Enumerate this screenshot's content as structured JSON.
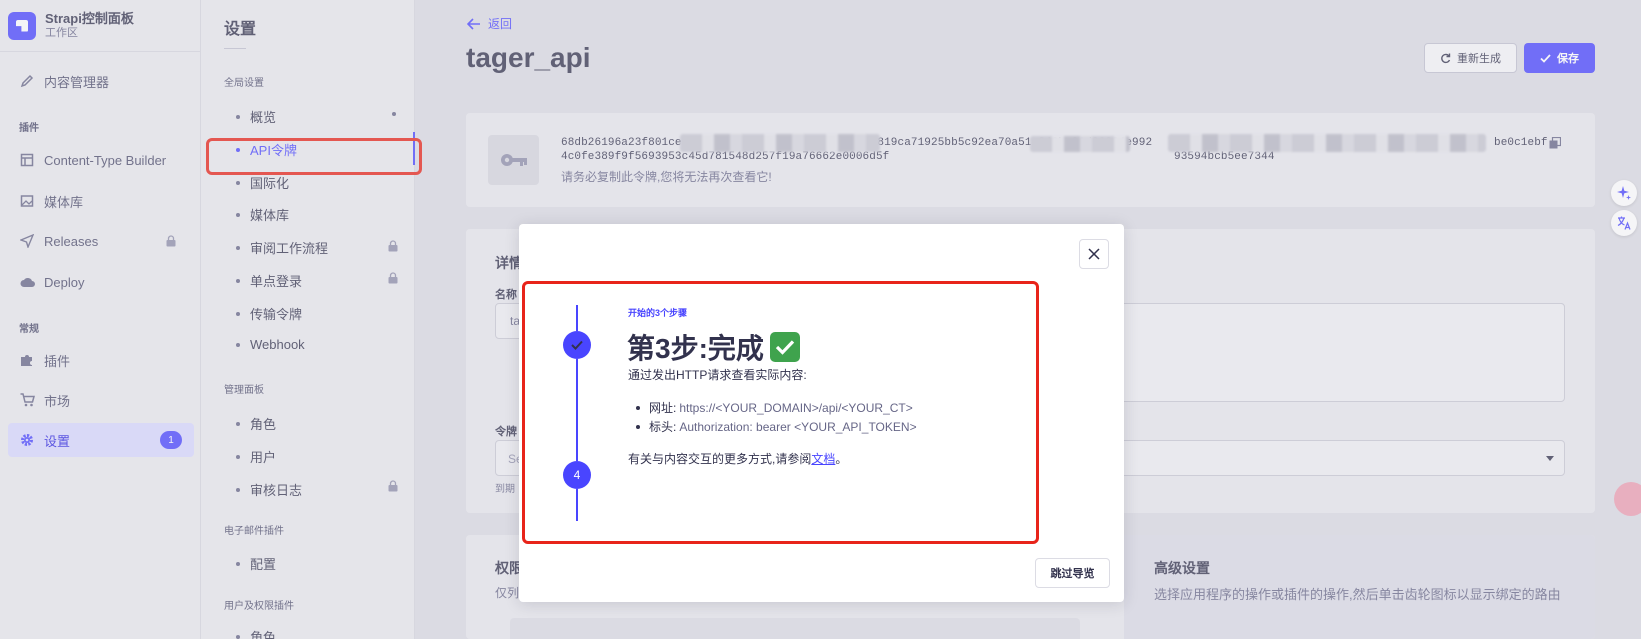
{
  "brand": {
    "title": "Strapi控制面板",
    "subtitle": "工作区"
  },
  "mainnav": {
    "content_manager": "内容管理器",
    "section_plugins": "插件",
    "content_type_builder": "Content-Type Builder",
    "media_library": "媒体库",
    "releases": "Releases",
    "deploy": "Deploy",
    "section_general": "常规",
    "plugins": "插件",
    "marketplace": "市场",
    "settings": "设置",
    "settings_badge": "1"
  },
  "subnav": {
    "title": "设置",
    "global_section": "全局设置",
    "global_items": [
      "概览",
      "API令牌",
      "国际化",
      "媒体库",
      "审阅工作流程",
      "单点登录",
      "传输令牌",
      "Webhook"
    ],
    "admin_section": "管理面板",
    "admin_items": [
      "角色",
      "用户",
      "审核日志"
    ],
    "email_section": "电子邮件插件",
    "email_items": [
      "配置"
    ],
    "users_section": "用户及权限插件",
    "users_items": [
      "角色"
    ]
  },
  "header": {
    "back": "返回",
    "title": "tager_api",
    "regenerate": "重新生成",
    "save": "保存"
  },
  "token": {
    "line1_start": "68db26196a23f801ce",
    "line1_mid": "22819ca71925bb5c92ea70a51c242bc81d86664e992",
    "line1_end": "be0c1ebf",
    "line2_start": "4c0fe389f9f5693953c45d781548d257f19a76662e0006d5f",
    "line2_end": "93594bcb5ee7344",
    "note": "请务必复制此令牌,您将无法再次查看它!"
  },
  "details": {
    "title": "详情",
    "name_label": "名称",
    "name_value": "ta",
    "token_label": "令牌",
    "select_value": "Se",
    "expiry_help": "到期"
  },
  "permissions": {
    "title": "权限",
    "desc": "仅列",
    "advanced_title": "高级设置",
    "advanced_desc": "选择应用程序的操作或插件的操作,然后单击齿轮图标以显示绑定的路由"
  },
  "modal": {
    "step_label": "开始的3个步骤",
    "step_title": "第3步:完成",
    "intro": "通过发出HTTP请求查看实际内容:",
    "bullets": [
      {
        "key": "网址:",
        "value": "https://<YOUR_DOMAIN>/api/<YOUR_CT>"
      },
      {
        "key": "标头:",
        "value": "Authorization: bearer <YOUR_API_TOKEN>"
      }
    ],
    "more_prefix": "有关与内容交互的更多方式,请参阅",
    "more_link": "文档",
    "more_suffix": "。",
    "step4": "4",
    "skip": "跳过导览"
  },
  "colors": {
    "primary": "#4945ff",
    "highlight": "#e8241a",
    "success": "#3fa34d"
  }
}
